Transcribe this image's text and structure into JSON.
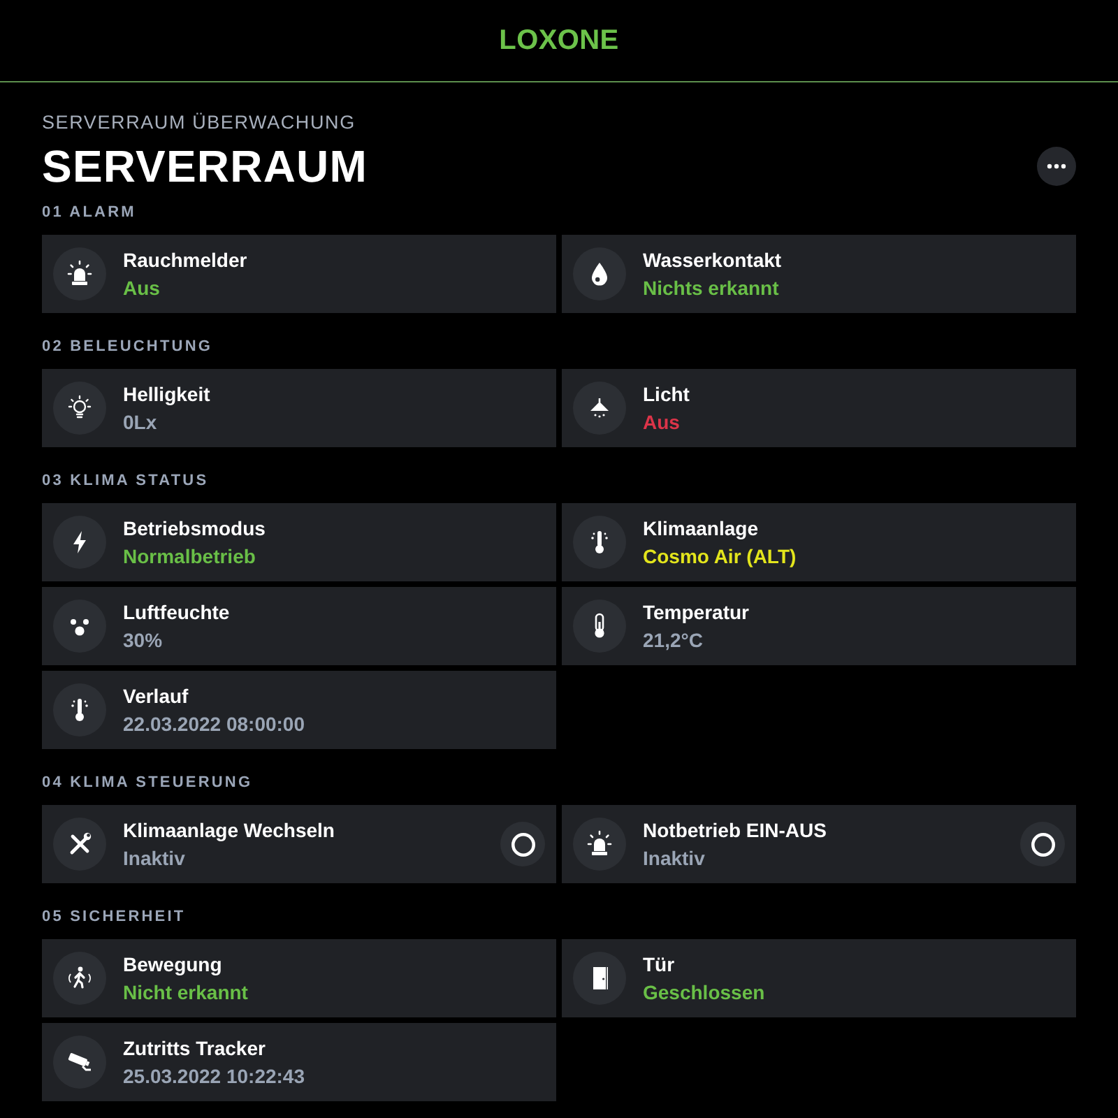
{
  "header": {
    "logo": "LOXONE"
  },
  "page": {
    "subtitle": "SERVERRAUM ÜBERWACHUNG",
    "title": "SERVERRAUM"
  },
  "sections": [
    {
      "title": "01 ALARM",
      "items": [
        {
          "kind": "status",
          "name": "Rauchmelder",
          "value": "Aus",
          "color": "#69bf47"
        },
        {
          "kind": "status",
          "name": "Wasserkontakt",
          "value": "Nichts erkannt",
          "color": "#69bf47"
        }
      ]
    },
    {
      "title": "02 BELEUCHTUNG",
      "items": [
        {
          "kind": "status",
          "name": "Helligkeit",
          "value": "0Lx",
          "color": "#9aa5b5"
        },
        {
          "kind": "status",
          "name": "Licht",
          "value": "Aus",
          "color": "#dc3449"
        }
      ]
    },
    {
      "title": "03 KLIMA STATUS",
      "items": [
        {
          "kind": "status",
          "name": "Betriebsmodus",
          "value": "Normalbetrieb",
          "color": "#69bf47"
        },
        {
          "kind": "status",
          "name": "Klimaanlage",
          "value": "Cosmo Air (ALT)",
          "color": "#e3e51c"
        },
        {
          "kind": "status",
          "name": "Luftfeuchte",
          "value": "30%",
          "color": "#9aa5b5"
        },
        {
          "kind": "status",
          "name": "Temperatur",
          "value": "21,2°C",
          "color": "#9aa5b5"
        },
        {
          "kind": "status",
          "name": "Verlauf",
          "value": "22.03.2022 08:00:00",
          "color": "#9aa5b5"
        }
      ]
    },
    {
      "title": "04 KLIMA STEUERUNG",
      "items": [
        {
          "kind": "switch",
          "name": "Klimaanlage Wechseln",
          "value": "Inaktiv",
          "color": "#9aa5b5",
          "on": false
        },
        {
          "kind": "switch",
          "name": "Notbetrieb EIN-AUS",
          "value": "Inaktiv",
          "color": "#9aa5b5",
          "on": false
        }
      ]
    },
    {
      "title": "05 SICHERHEIT",
      "items": [
        {
          "kind": "status",
          "name": "Bewegung",
          "value": "Nicht erkannt",
          "color": "#69bf47"
        },
        {
          "kind": "status",
          "name": "Tür",
          "value": "Geschlossen",
          "color": "#69bf47"
        },
        {
          "kind": "status",
          "name": "Zutritts Tracker",
          "value": "25.03.2022 10:22:43",
          "color": "#9aa5b5"
        }
      ]
    }
  ]
}
